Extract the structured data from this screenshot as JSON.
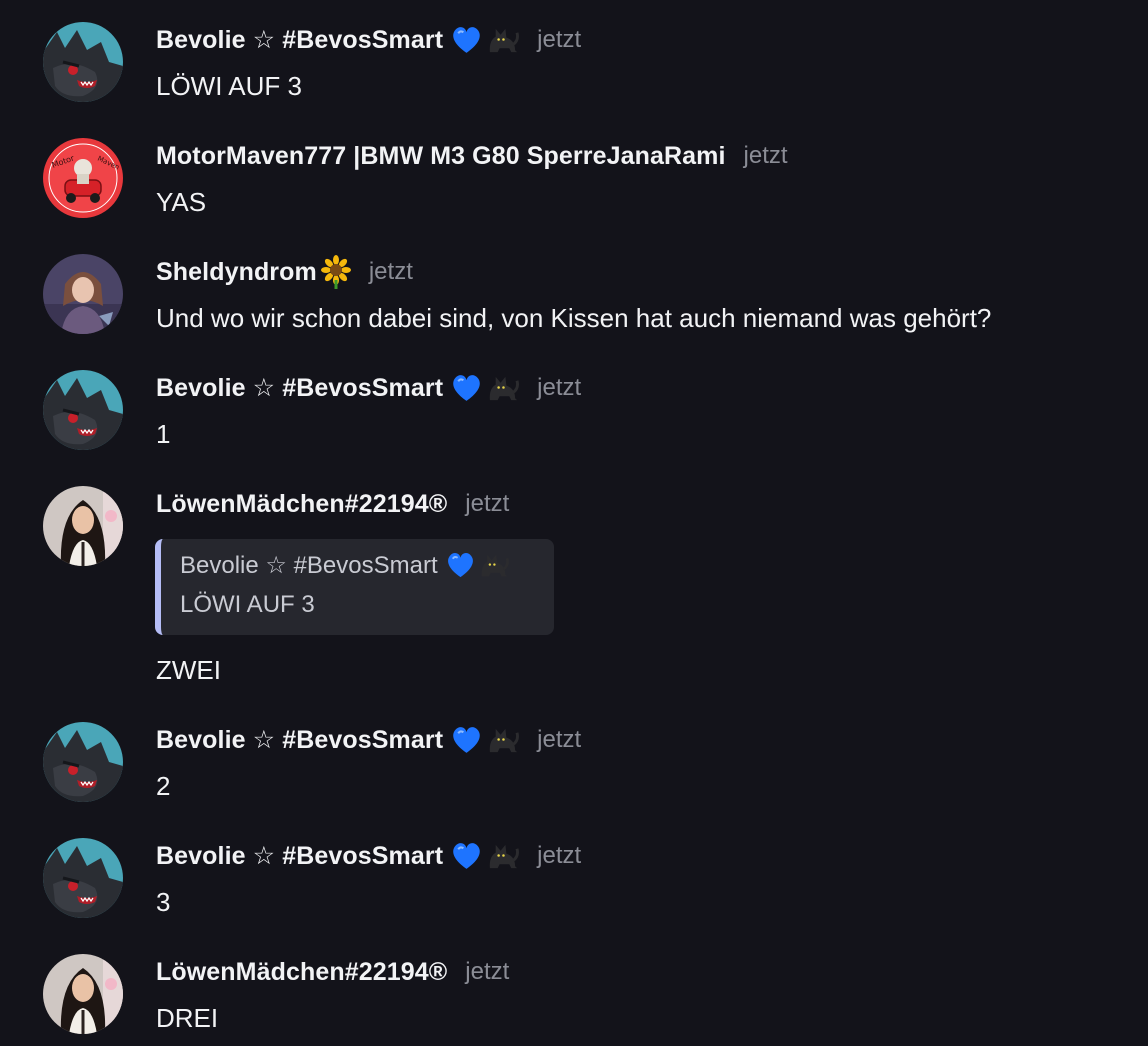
{
  "colors": {
    "background": "#13131a",
    "text": "#f2f3f5",
    "timestamp": "#8b8d96",
    "reply_bar": "#b5bdf6",
    "reply_bg": "#26272e"
  },
  "messages": [
    {
      "author": "Bevolie ☆ #BevosSmart",
      "time": "jetzt",
      "text": "LÖWI AUF 3",
      "avatar": "wolf-avatar",
      "emojis": [
        "blue-heart-icon",
        "black-cat-icon"
      ]
    },
    {
      "author": "MotorMaven777 |BMW M3 G80 SperreJanaRami",
      "time": "jetzt",
      "text": "YAS",
      "avatar": "motor-maven-avatar"
    },
    {
      "author": "Sheldyndrom",
      "time": "jetzt",
      "text": "Und wo wir schon dabei sind, von Kissen hat auch niemand was gehört?",
      "avatar": "anime-avatar",
      "emojis": [
        "sunflower-icon"
      ]
    },
    {
      "author": "Bevolie ☆ #BevosSmart",
      "time": "jetzt",
      "text": "1",
      "avatar": "wolf-avatar",
      "emojis": [
        "blue-heart-icon",
        "black-cat-icon"
      ]
    },
    {
      "author": "LöwenMädchen#22194®",
      "time": "jetzt",
      "text": "ZWEI",
      "avatar": "girl-avatar",
      "reply": {
        "author": "Bevolie ☆ #BevosSmart",
        "text": "LÖWI AUF 3",
        "emojis": [
          "blue-heart-icon",
          "black-cat-icon"
        ]
      }
    },
    {
      "author": "Bevolie ☆ #BevosSmart",
      "time": "jetzt",
      "text": "2",
      "avatar": "wolf-avatar",
      "emojis": [
        "blue-heart-icon",
        "black-cat-icon"
      ]
    },
    {
      "author": "Bevolie ☆ #BevosSmart",
      "time": "jetzt",
      "text": "3",
      "avatar": "wolf-avatar",
      "emojis": [
        "blue-heart-icon",
        "black-cat-icon"
      ]
    },
    {
      "author": "LöwenMädchen#22194®",
      "time": "jetzt",
      "text": "DREI",
      "avatar": "girl-avatar"
    }
  ]
}
